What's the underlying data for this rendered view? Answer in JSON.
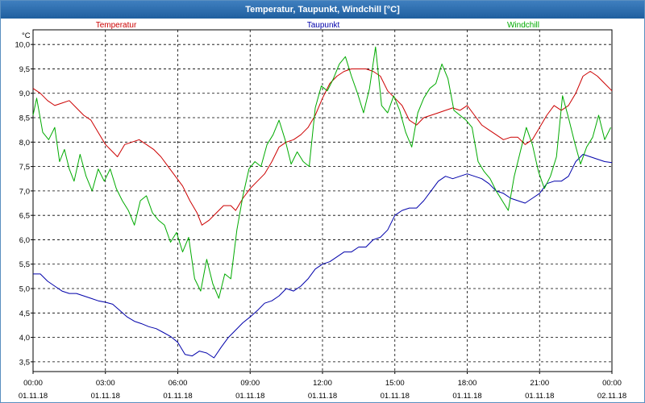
{
  "window": {
    "title": "Temperatur, Taupunkt, Windchill [°C]"
  },
  "chart_data": {
    "type": "line",
    "title": "Temperatur, Taupunkt, Windchill [°C]",
    "ylabel": "°C",
    "xlabel": "",
    "ylim": [
      3.3,
      10.3
    ],
    "xlim": [
      0,
      24
    ],
    "grid": true,
    "legend_placement": "top",
    "y_ticks": [
      "3,5",
      "4,0",
      "4,5",
      "5,0",
      "5,5",
      "6,0",
      "6,5",
      "7,0",
      "7,5",
      "8,0",
      "8,5",
      "9,0",
      "9,5",
      "10,0"
    ],
    "y_tick_values": [
      3.5,
      4.0,
      4.5,
      5.0,
      5.5,
      6.0,
      6.5,
      7.0,
      7.5,
      8.0,
      8.5,
      9.0,
      9.5,
      10.0
    ],
    "x_ticks": [
      {
        "time": "00:00",
        "date": "01.11.18",
        "hour": 0
      },
      {
        "time": "03:00",
        "date": "01.11.18",
        "hour": 3
      },
      {
        "time": "06:00",
        "date": "01.11.18",
        "hour": 6
      },
      {
        "time": "09:00",
        "date": "01.11.18",
        "hour": 9
      },
      {
        "time": "12:00",
        "date": "01.11.18",
        "hour": 12
      },
      {
        "time": "15:00",
        "date": "01.11.18",
        "hour": 15
      },
      {
        "time": "18:00",
        "date": "01.11.18",
        "hour": 18
      },
      {
        "time": "21:00",
        "date": "01.11.18",
        "hour": 21
      },
      {
        "time": "00:00",
        "date": "02.11.18",
        "hour": 24
      }
    ],
    "series": [
      {
        "name": "Temperatur",
        "color": "#cc0000",
        "points": [
          [
            0,
            9.1
          ],
          [
            0.3,
            9.0
          ],
          [
            0.6,
            8.85
          ],
          [
            0.9,
            8.75
          ],
          [
            1.2,
            8.8
          ],
          [
            1.5,
            8.85
          ],
          [
            1.8,
            8.7
          ],
          [
            2.1,
            8.55
          ],
          [
            2.4,
            8.45
          ],
          [
            2.7,
            8.2
          ],
          [
            3.0,
            7.95
          ],
          [
            3.3,
            7.8
          ],
          [
            3.5,
            7.7
          ],
          [
            3.8,
            7.95
          ],
          [
            4.1,
            8.0
          ],
          [
            4.4,
            8.05
          ],
          [
            4.7,
            7.95
          ],
          [
            5.0,
            7.85
          ],
          [
            5.3,
            7.7
          ],
          [
            5.6,
            7.5
          ],
          [
            5.9,
            7.3
          ],
          [
            6.2,
            7.1
          ],
          [
            6.5,
            6.8
          ],
          [
            6.8,
            6.55
          ],
          [
            7.0,
            6.3
          ],
          [
            7.3,
            6.4
          ],
          [
            7.6,
            6.55
          ],
          [
            7.9,
            6.7
          ],
          [
            8.2,
            6.7
          ],
          [
            8.4,
            6.6
          ],
          [
            8.7,
            6.85
          ],
          [
            9.0,
            7.05
          ],
          [
            9.3,
            7.2
          ],
          [
            9.6,
            7.35
          ],
          [
            9.9,
            7.6
          ],
          [
            10.2,
            7.9
          ],
          [
            10.5,
            8.0
          ],
          [
            10.8,
            8.05
          ],
          [
            11.1,
            8.15
          ],
          [
            11.4,
            8.3
          ],
          [
            11.7,
            8.55
          ],
          [
            12.0,
            8.9
          ],
          [
            12.3,
            9.2
          ],
          [
            12.6,
            9.35
          ],
          [
            12.9,
            9.45
          ],
          [
            13.2,
            9.5
          ],
          [
            13.5,
            9.5
          ],
          [
            13.8,
            9.5
          ],
          [
            14.1,
            9.45
          ],
          [
            14.4,
            9.35
          ],
          [
            14.7,
            9.05
          ],
          [
            15.0,
            8.9
          ],
          [
            15.3,
            8.75
          ],
          [
            15.6,
            8.45
          ],
          [
            15.9,
            8.35
          ],
          [
            16.2,
            8.5
          ],
          [
            16.5,
            8.55
          ],
          [
            16.8,
            8.6
          ],
          [
            17.1,
            8.65
          ],
          [
            17.4,
            8.7
          ],
          [
            17.7,
            8.65
          ],
          [
            18.0,
            8.75
          ],
          [
            18.3,
            8.55
          ],
          [
            18.6,
            8.35
          ],
          [
            18.9,
            8.25
          ],
          [
            19.2,
            8.15
          ],
          [
            19.5,
            8.05
          ],
          [
            19.8,
            8.1
          ],
          [
            20.1,
            8.1
          ],
          [
            20.4,
            7.95
          ],
          [
            20.7,
            8.05
          ],
          [
            21.0,
            8.3
          ],
          [
            21.3,
            8.55
          ],
          [
            21.6,
            8.75
          ],
          [
            21.9,
            8.65
          ],
          [
            22.2,
            8.75
          ],
          [
            22.5,
            9.0
          ],
          [
            22.8,
            9.35
          ],
          [
            23.1,
            9.45
          ],
          [
            23.4,
            9.35
          ],
          [
            23.7,
            9.2
          ],
          [
            24.0,
            9.05
          ]
        ]
      },
      {
        "name": "Taupunkt",
        "color": "#0000aa",
        "points": [
          [
            0,
            5.3
          ],
          [
            0.3,
            5.3
          ],
          [
            0.6,
            5.15
          ],
          [
            0.9,
            5.05
          ],
          [
            1.2,
            4.95
          ],
          [
            1.5,
            4.9
          ],
          [
            1.8,
            4.9
          ],
          [
            2.1,
            4.85
          ],
          [
            2.4,
            4.8
          ],
          [
            2.7,
            4.75
          ],
          [
            3.0,
            4.72
          ],
          [
            3.3,
            4.68
          ],
          [
            3.6,
            4.55
          ],
          [
            3.9,
            4.42
          ],
          [
            4.2,
            4.33
          ],
          [
            4.5,
            4.28
          ],
          [
            4.8,
            4.22
          ],
          [
            5.1,
            4.18
          ],
          [
            5.4,
            4.1
          ],
          [
            5.7,
            4.02
          ],
          [
            6.0,
            3.9
          ],
          [
            6.3,
            3.65
          ],
          [
            6.6,
            3.62
          ],
          [
            6.9,
            3.72
          ],
          [
            7.2,
            3.68
          ],
          [
            7.5,
            3.58
          ],
          [
            7.8,
            3.8
          ],
          [
            8.1,
            4.0
          ],
          [
            8.4,
            4.15
          ],
          [
            8.7,
            4.3
          ],
          [
            9.0,
            4.42
          ],
          [
            9.3,
            4.55
          ],
          [
            9.6,
            4.7
          ],
          [
            9.9,
            4.75
          ],
          [
            10.2,
            4.85
          ],
          [
            10.5,
            5.0
          ],
          [
            10.8,
            4.95
          ],
          [
            11.1,
            5.05
          ],
          [
            11.4,
            5.2
          ],
          [
            11.7,
            5.4
          ],
          [
            12.0,
            5.5
          ],
          [
            12.3,
            5.55
          ],
          [
            12.6,
            5.65
          ],
          [
            12.9,
            5.75
          ],
          [
            13.2,
            5.75
          ],
          [
            13.5,
            5.85
          ],
          [
            13.8,
            5.85
          ],
          [
            14.1,
            6.0
          ],
          [
            14.4,
            6.05
          ],
          [
            14.7,
            6.2
          ],
          [
            15.0,
            6.5
          ],
          [
            15.3,
            6.6
          ],
          [
            15.6,
            6.65
          ],
          [
            15.9,
            6.65
          ],
          [
            16.2,
            6.8
          ],
          [
            16.5,
            7.0
          ],
          [
            16.8,
            7.2
          ],
          [
            17.1,
            7.3
          ],
          [
            17.4,
            7.25
          ],
          [
            17.7,
            7.3
          ],
          [
            18.0,
            7.35
          ],
          [
            18.3,
            7.3
          ],
          [
            18.6,
            7.25
          ],
          [
            18.9,
            7.15
          ],
          [
            19.2,
            7.0
          ],
          [
            19.5,
            6.95
          ],
          [
            19.8,
            6.85
          ],
          [
            20.1,
            6.8
          ],
          [
            20.4,
            6.75
          ],
          [
            20.7,
            6.85
          ],
          [
            21.0,
            6.95
          ],
          [
            21.3,
            7.15
          ],
          [
            21.6,
            7.2
          ],
          [
            21.9,
            7.2
          ],
          [
            22.2,
            7.3
          ],
          [
            22.5,
            7.6
          ],
          [
            22.8,
            7.75
          ],
          [
            23.1,
            7.7
          ],
          [
            23.4,
            7.65
          ],
          [
            23.7,
            7.6
          ],
          [
            24.0,
            7.58
          ]
        ]
      },
      {
        "name": "Windchill",
        "color": "#00aa00",
        "points": [
          [
            0,
            8.55
          ],
          [
            0.15,
            8.9
          ],
          [
            0.4,
            8.2
          ],
          [
            0.65,
            8.05
          ],
          [
            0.9,
            8.3
          ],
          [
            1.1,
            7.6
          ],
          [
            1.3,
            7.85
          ],
          [
            1.5,
            7.45
          ],
          [
            1.7,
            7.2
          ],
          [
            1.95,
            7.75
          ],
          [
            2.2,
            7.3
          ],
          [
            2.45,
            7.0
          ],
          [
            2.7,
            7.45
          ],
          [
            2.95,
            7.2
          ],
          [
            3.2,
            7.45
          ],
          [
            3.45,
            7.05
          ],
          [
            3.7,
            6.8
          ],
          [
            3.95,
            6.6
          ],
          [
            4.2,
            6.3
          ],
          [
            4.45,
            6.8
          ],
          [
            4.7,
            6.9
          ],
          [
            4.95,
            6.55
          ],
          [
            5.2,
            6.4
          ],
          [
            5.45,
            6.3
          ],
          [
            5.7,
            5.95
          ],
          [
            5.95,
            6.15
          ],
          [
            6.2,
            5.75
          ],
          [
            6.45,
            6.05
          ],
          [
            6.7,
            5.2
          ],
          [
            6.95,
            4.95
          ],
          [
            7.2,
            5.6
          ],
          [
            7.45,
            5.1
          ],
          [
            7.7,
            4.8
          ],
          [
            7.95,
            5.3
          ],
          [
            8.2,
            5.2
          ],
          [
            8.45,
            6.2
          ],
          [
            8.7,
            6.9
          ],
          [
            8.95,
            7.45
          ],
          [
            9.2,
            7.6
          ],
          [
            9.45,
            7.5
          ],
          [
            9.7,
            7.95
          ],
          [
            9.95,
            8.15
          ],
          [
            10.2,
            8.45
          ],
          [
            10.45,
            8.05
          ],
          [
            10.7,
            7.55
          ],
          [
            10.95,
            7.8
          ],
          [
            11.2,
            7.6
          ],
          [
            11.45,
            7.5
          ],
          [
            11.7,
            8.7
          ],
          [
            11.95,
            9.15
          ],
          [
            12.2,
            9.05
          ],
          [
            12.45,
            9.3
          ],
          [
            12.7,
            9.6
          ],
          [
            12.95,
            9.75
          ],
          [
            13.2,
            9.35
          ],
          [
            13.45,
            9.0
          ],
          [
            13.7,
            8.6
          ],
          [
            13.95,
            9.1
          ],
          [
            14.2,
            9.95
          ],
          [
            14.45,
            8.75
          ],
          [
            14.7,
            8.6
          ],
          [
            14.95,
            8.95
          ],
          [
            15.2,
            8.65
          ],
          [
            15.45,
            8.2
          ],
          [
            15.7,
            7.9
          ],
          [
            15.95,
            8.6
          ],
          [
            16.2,
            8.9
          ],
          [
            16.45,
            9.1
          ],
          [
            16.7,
            9.2
          ],
          [
            16.95,
            9.6
          ],
          [
            17.2,
            9.3
          ],
          [
            17.45,
            8.65
          ],
          [
            17.7,
            8.55
          ],
          [
            17.95,
            8.45
          ],
          [
            18.2,
            8.3
          ],
          [
            18.45,
            7.6
          ],
          [
            18.7,
            7.4
          ],
          [
            18.95,
            7.25
          ],
          [
            19.2,
            7.0
          ],
          [
            19.45,
            6.8
          ],
          [
            19.7,
            6.6
          ],
          [
            19.95,
            7.3
          ],
          [
            20.2,
            7.8
          ],
          [
            20.45,
            8.3
          ],
          [
            20.7,
            7.95
          ],
          [
            20.95,
            7.4
          ],
          [
            21.2,
            7.05
          ],
          [
            21.45,
            7.3
          ],
          [
            21.7,
            7.7
          ],
          [
            21.95,
            8.95
          ],
          [
            22.2,
            8.5
          ],
          [
            22.45,
            8.0
          ],
          [
            22.7,
            7.55
          ],
          [
            22.95,
            7.9
          ],
          [
            23.2,
            8.1
          ],
          [
            23.45,
            8.55
          ],
          [
            23.7,
            8.05
          ],
          [
            23.95,
            8.3
          ]
        ]
      }
    ]
  }
}
